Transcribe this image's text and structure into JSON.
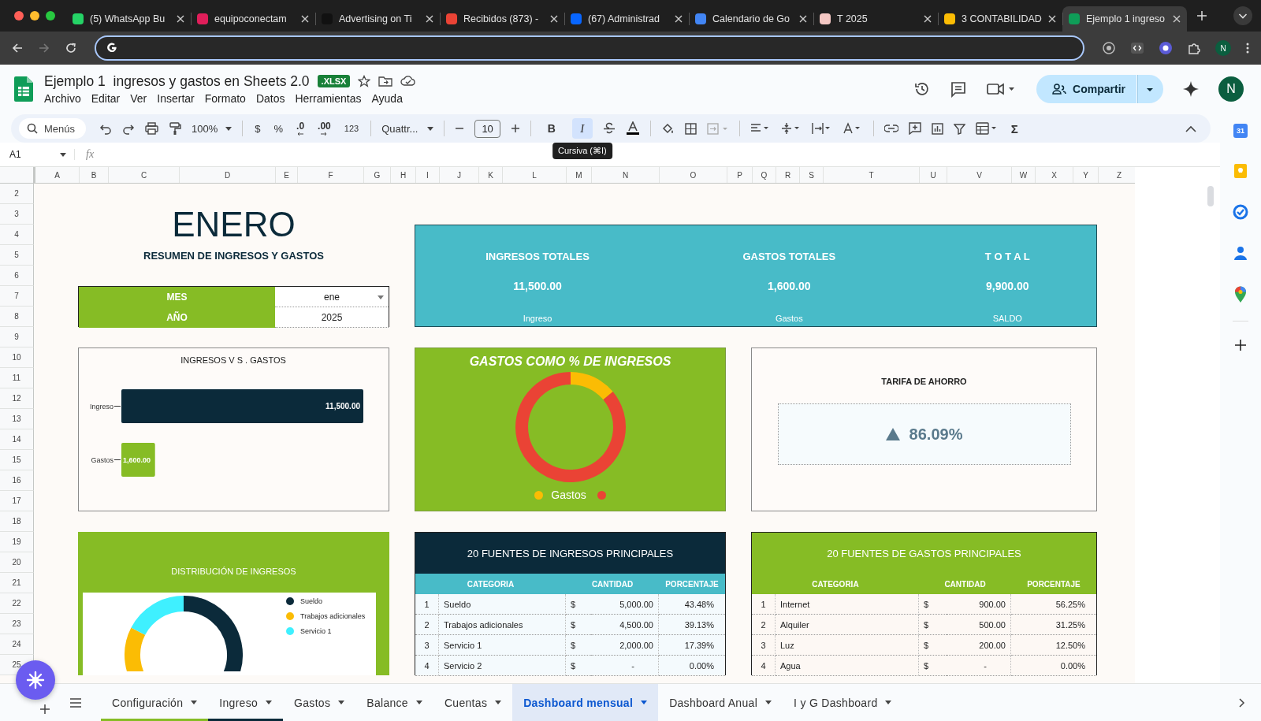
{
  "browser": {
    "tabs": [
      {
        "title": "(5) WhatsApp Bu",
        "color": "#25d366",
        "selected": false
      },
      {
        "title": "equipoconectam",
        "color": "#e01e5a",
        "selected": false
      },
      {
        "title": "Advertising on Ti",
        "color": "#111111",
        "selected": false
      },
      {
        "title": "Recibidos (873) -",
        "color": "#ea4335",
        "selected": false
      },
      {
        "title": "(67) Administrad",
        "color": "#0866ff",
        "selected": false
      },
      {
        "title": "Calendario de Go",
        "color": "#4285f4",
        "selected": false
      },
      {
        "title": "T 2025",
        "color": "#f4c7c3",
        "selected": false
      },
      {
        "title": "3 CONTABILIDAD",
        "color": "#fbbc04",
        "selected": false
      },
      {
        "title": "Ejemplo 1 ingreso",
        "color": "#0f9d58",
        "selected": true
      }
    ],
    "profile_initial": "N"
  },
  "document": {
    "title": "Ejemplo 1  ingresos y gastos en Sheets 2.0",
    "format_badge": ".XLSX",
    "menu": [
      "Archivo",
      "Editar",
      "Ver",
      "Insertar",
      "Formato",
      "Datos",
      "Herramientas",
      "Ayuda"
    ],
    "share_label": "Compartir",
    "avatar_initial": "N"
  },
  "toolbar": {
    "search_label": "Menús",
    "zoom": "100%",
    "currency": "$",
    "percent": "%",
    "decrease_decimals": ".0",
    "increase_decimals": ".00",
    "number_format": "123",
    "font": "Quattr...",
    "font_size": "10",
    "format_buttons": [
      {
        "label": "B",
        "kind": "bold",
        "selected": false
      },
      {
        "label": "I",
        "kind": "italic",
        "selected": true
      }
    ],
    "sum": "Σ",
    "tooltip": "Cursiva (⌘I)"
  },
  "formula_bar": {
    "cell": "A1",
    "fx": "fx"
  },
  "sheet": {
    "columns": [
      "A",
      "B",
      "C",
      "D",
      "E",
      "F",
      "G",
      "H",
      "I",
      "J",
      "K",
      "L",
      "M",
      "N",
      "O",
      "P",
      "Q",
      "R",
      "S",
      "T",
      "U",
      "V",
      "W",
      "X",
      "Y",
      "Z"
    ],
    "rows": [
      "2",
      "3",
      "4",
      "5",
      "6",
      "7",
      "8",
      "9",
      "10",
      "11",
      "12",
      "13",
      "14",
      "15",
      "16",
      "17",
      "18",
      "19",
      "20",
      "21",
      "22",
      "23",
      "24",
      "25"
    ]
  },
  "dashboard": {
    "month_title": "ENERO",
    "subtitle": "RESUMEN DE INGRESOS Y GASTOS",
    "period": [
      {
        "label": "MES",
        "value": "ene",
        "kind": "dropdown"
      },
      {
        "label": "AÑO",
        "value": "2025",
        "kind": "plain"
      }
    ],
    "totals": [
      {
        "heading": "INGRESOS TOTALES",
        "value": "11,500.00",
        "caption": "Ingreso"
      },
      {
        "heading": "GASTOS TOTALES",
        "value": "1,600.00",
        "caption": "Gastos"
      },
      {
        "heading": "T O T A L",
        "value": "9,900.00",
        "caption": "SALDO"
      }
    ],
    "bar_chart": {
      "chart_data": {
        "type": "bar",
        "orientation": "horizontal",
        "title": "INGRESOS  V S .   GASTOS",
        "categories": [
          "Ingreso",
          "Gastos"
        ],
        "values": [
          11500,
          1600
        ],
        "value_labels": [
          "11,500.00",
          "1,600.00"
        ]
      }
    },
    "expense_ratio": {
      "title": "GASTOS COMO % DE INGRESOS",
      "legend": [
        {
          "label": "Gastos",
          "color": "#fbbc04"
        },
        {
          "color": "#ea4335"
        }
      ]
    },
    "savings_rate": {
      "title": "TARIFA DE AHORRO",
      "value": "86.09%",
      "increase": true
    },
    "income_distribution": {
      "title": "DISTRIBUCIÓN DE INGRESOS",
      "legend": [
        {
          "label": "Sueldo",
          "color": "#0b2a3a"
        },
        {
          "label": "Trabajos adicionales",
          "color": "#fbbc04"
        },
        {
          "label": "Servicio 1",
          "color": "#3ff0ff"
        }
      ]
    },
    "income_table": {
      "title": "20 FUENTES DE INGRESOS PRINCIPALES",
      "columns": [
        "CATEGORIA",
        "CANTIDAD",
        "PORCENTAJE"
      ],
      "rows": [
        {
          "rank": "1",
          "category": "Sueldo",
          "currency": "$",
          "amount": "5,000.00",
          "share": "43.48%"
        },
        {
          "rank": "2",
          "category": "Trabajos adicionales",
          "currency": "$",
          "amount": "4,500.00",
          "share": "39.13%"
        },
        {
          "rank": "3",
          "category": "Servicio 1",
          "currency": "$",
          "amount": "2,000.00",
          "share": "17.39%"
        },
        {
          "rank": "4",
          "category": "Servicio 2",
          "currency": "$",
          "amount": "-",
          "share": "0.00%"
        }
      ]
    },
    "expense_table": {
      "title": "20 FUENTES DE GASTOS PRINCIPALES",
      "columns": [
        "CATEGORIA",
        "CANTIDAD",
        "PORCENTAJE"
      ],
      "rows": [
        {
          "rank": "1",
          "category": "Internet",
          "currency": "$",
          "amount": "900.00",
          "share": "56.25%"
        },
        {
          "rank": "2",
          "category": "Alquiler",
          "currency": "$",
          "amount": "500.00",
          "share": "31.25%"
        },
        {
          "rank": "3",
          "category": "Luz",
          "currency": "$",
          "amount": "200.00",
          "share": "12.50%"
        },
        {
          "rank": "4",
          "category": "Agua",
          "currency": "$",
          "amount": "-",
          "share": "0.00%"
        }
      ]
    }
  },
  "sheet_tabs": [
    {
      "label": "Configuración",
      "selected": false,
      "color": "#86bc25"
    },
    {
      "label": "Ingreso",
      "selected": false,
      "color": "#0b2a3a"
    },
    {
      "label": "Gastos",
      "selected": false
    },
    {
      "label": "Balance",
      "selected": false
    },
    {
      "label": "Cuentas",
      "selected": false
    },
    {
      "label": "Dashboard mensual",
      "selected": true
    },
    {
      "label": "Dashboard Anual",
      "selected": false
    },
    {
      "label": "I y G Dashboard",
      "selected": false
    }
  ],
  "side_panel": {
    "calendar_day": "31"
  }
}
